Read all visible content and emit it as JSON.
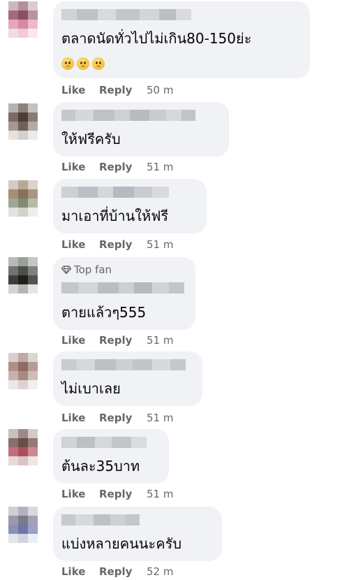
{
  "actions": {
    "like": "Like",
    "reply": "Reply"
  },
  "comments": [
    {
      "text": "ตลาดนัดทั่วไปไม่เกิน80-150ย่ะ",
      "emoji": [
        "sad-face-icon",
        "sad-face-icon",
        "sad-face-icon"
      ],
      "time": "50 m"
    },
    {
      "text": "ให้ฟรีครับ",
      "time": "51 m"
    },
    {
      "text": "มาเอาที่บ้านให้ฟรี",
      "time": "51 m"
    },
    {
      "badge": "Top fan",
      "text": "ตายแล้วๆ555",
      "time": "51 m"
    },
    {
      "text": "ไม่เบาเลย",
      "time": "51 m"
    },
    {
      "text": "ต้นละ35บาท",
      "time": "51 m"
    },
    {
      "text": "แบ่งหลายคนนะครับ",
      "time": "52 m"
    }
  ]
}
